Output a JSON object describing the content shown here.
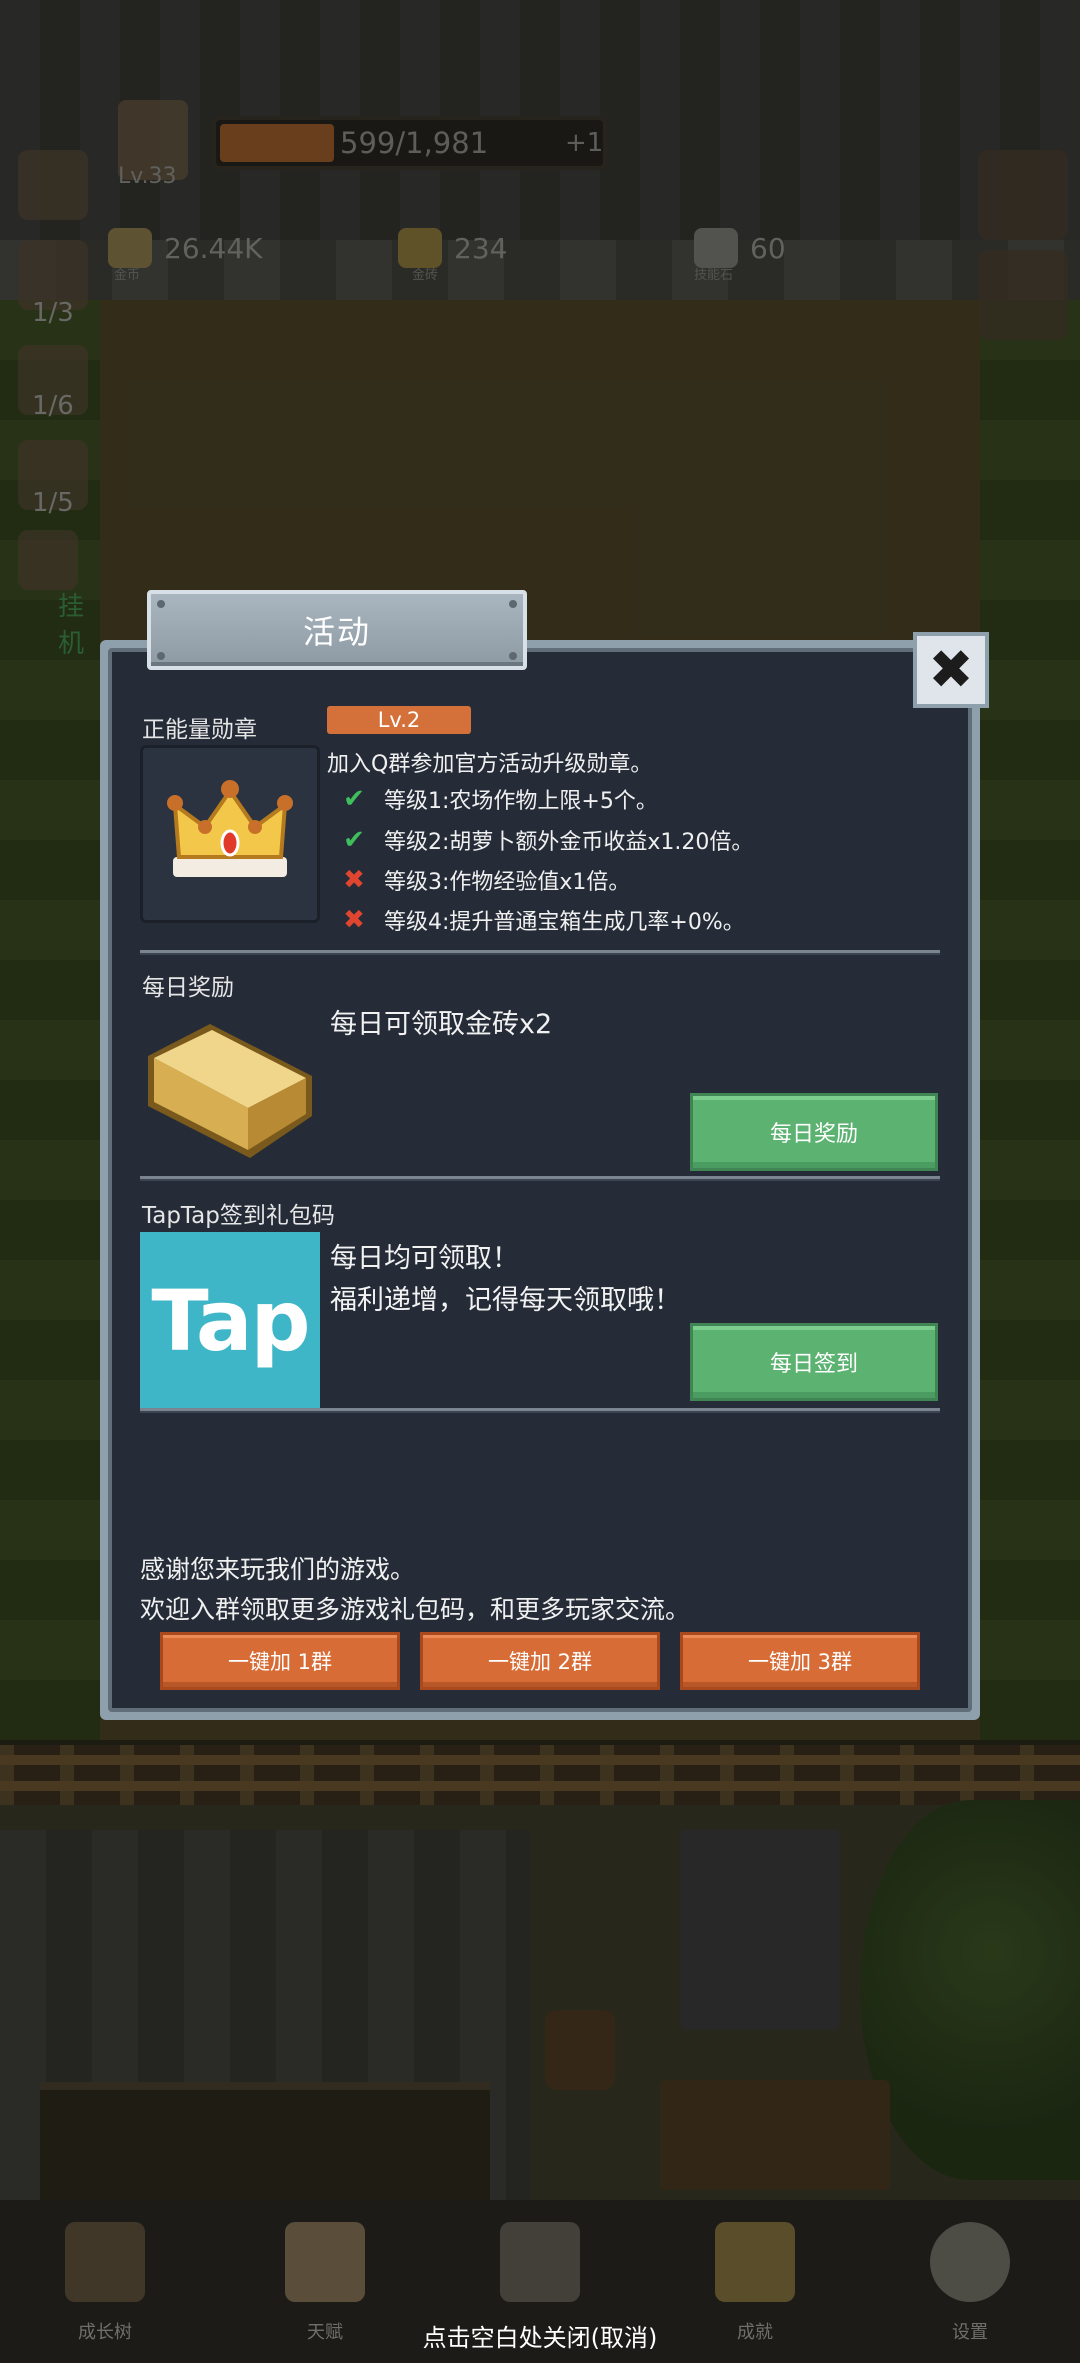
{
  "hud": {
    "level": "Lv.33",
    "xp_text": "599/1,981",
    "xp_fraction": 0.3,
    "xp_plus": "+1",
    "resources": [
      {
        "value": "26.44K",
        "label": "金币"
      },
      {
        "value": "234",
        "label": "金砖"
      },
      {
        "value": "60",
        "label": "技能石"
      }
    ],
    "side_counts": [
      "1/3",
      "1/6",
      "1/5"
    ],
    "side_label_partial": "挂机"
  },
  "dialog": {
    "title": "活动",
    "close_glyph": "✖",
    "badge_section": {
      "label": "正能量勋章",
      "level_badge": "Lv.2",
      "description": "加入Q群参加官方活动升级勋章。",
      "perks": [
        {
          "text": "等级1:农场作物上限+5个。",
          "unlocked": true
        },
        {
          "text": "等级2:胡萝卜额外金币收益x1.20倍。",
          "unlocked": true
        },
        {
          "text": "等级3:作物经验值x1倍。",
          "unlocked": false
        },
        {
          "text": "等级4:提升普通宝箱生成几率+0%。",
          "unlocked": false
        }
      ]
    },
    "daily_section": {
      "label": "每日奖励",
      "reward_text": "每日可领取金砖x2",
      "button": "每日奖励"
    },
    "taptap_section": {
      "label": "TapTap签到礼包码",
      "logo_text": "Tap",
      "line1": "每日均可领取！",
      "line2": "福利递增，记得每天领取哦！",
      "button": "每日签到"
    },
    "footer": {
      "line1": "感谢您来玩我们的游戏。",
      "line2": "欢迎入群领取更多游戏礼包码，和更多玩家交流。",
      "buttons": [
        "一键加 1群",
        "一键加 2群",
        "一键加 3群"
      ]
    }
  },
  "nav": {
    "items": [
      "成长树",
      "天赋",
      "",
      "成就",
      "设置"
    ],
    "close_hint": "点击空白处关闭(取消)"
  },
  "colors": {
    "panel_bg": "#252c38",
    "panel_frame": "#8fa0ad",
    "accent_orange": "#d86c36",
    "accent_green": "#5cb271",
    "check": "#3fbf5c",
    "cross": "#e0452f"
  }
}
